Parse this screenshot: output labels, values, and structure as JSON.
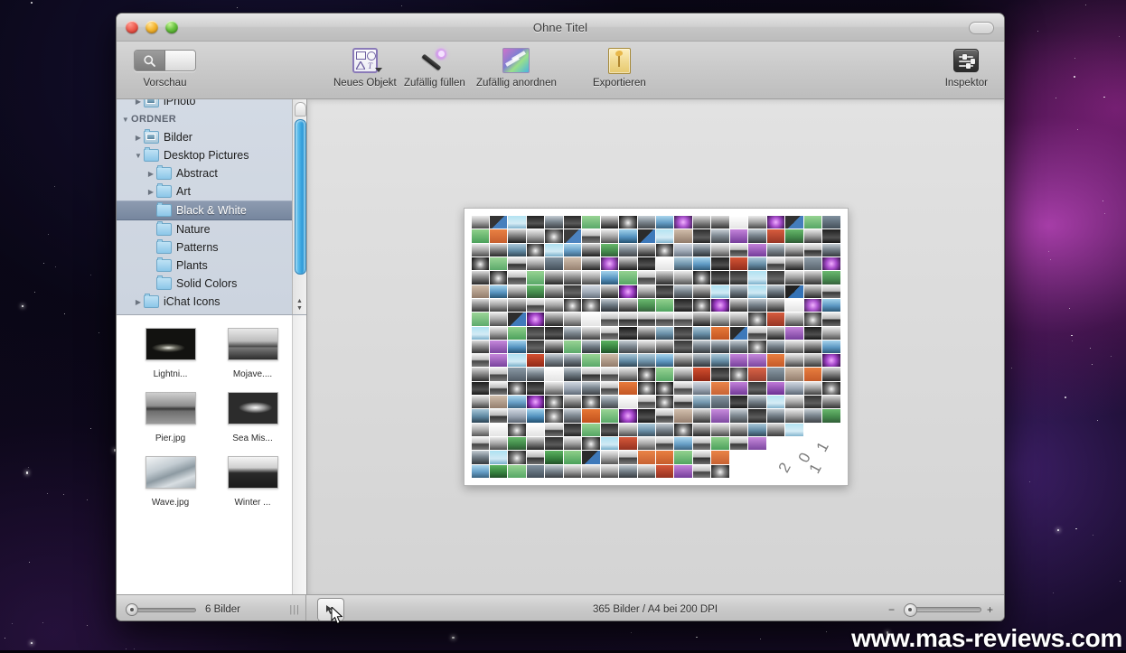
{
  "window": {
    "title": "Ohne Titel",
    "traffic_lights": [
      "close",
      "minimize",
      "zoom"
    ],
    "toolbar_toggle": "toolbar-toggle-pill"
  },
  "toolbar": {
    "items": [
      {
        "label": "Vorschau",
        "icon": "magnifier-icon",
        "type": "segmented"
      },
      {
        "label": "Neues Objekt",
        "icon": "new-object-icon",
        "type": "menu-button"
      },
      {
        "label": "Zufällig füllen",
        "icon": "magic-wand-icon",
        "type": "button"
      },
      {
        "label": "Zufällig anordnen",
        "icon": "shuffle-icon",
        "type": "button"
      },
      {
        "label": "Exportieren",
        "icon": "export-icon",
        "type": "button"
      },
      {
        "label": "Inspektor",
        "icon": "inspector-icon",
        "type": "button"
      }
    ]
  },
  "sidebar": {
    "tree": [
      {
        "label": "iPhoto",
        "depth": 1,
        "caret": "closed",
        "icon": "photo-folder-icon",
        "selected": false,
        "clipped": true
      },
      {
        "label": "ORDNER",
        "depth": 0,
        "caret": "open",
        "icon": "none",
        "selected": false,
        "group": true
      },
      {
        "label": "Bilder",
        "depth": 1,
        "caret": "closed",
        "icon": "photo-folder-icon",
        "selected": false
      },
      {
        "label": "Desktop Pictures",
        "depth": 1,
        "caret": "open",
        "icon": "folder-icon",
        "selected": false
      },
      {
        "label": "Abstract",
        "depth": 2,
        "caret": "closed",
        "icon": "folder-icon",
        "selected": false
      },
      {
        "label": "Art",
        "depth": 2,
        "caret": "closed",
        "icon": "folder-icon",
        "selected": false
      },
      {
        "label": "Black & White",
        "depth": 2,
        "caret": "none",
        "icon": "folder-icon",
        "selected": true
      },
      {
        "label": "Nature",
        "depth": 2,
        "caret": "none",
        "icon": "folder-icon",
        "selected": false
      },
      {
        "label": "Patterns",
        "depth": 2,
        "caret": "none",
        "icon": "folder-icon",
        "selected": false
      },
      {
        "label": "Plants",
        "depth": 2,
        "caret": "none",
        "icon": "folder-icon",
        "selected": false
      },
      {
        "label": "Solid Colors",
        "depth": 2,
        "caret": "none",
        "icon": "folder-icon",
        "selected": false
      },
      {
        "label": "iChat Icons",
        "depth": 1,
        "caret": "closed",
        "icon": "folder-icon",
        "selected": false
      }
    ],
    "thumbnails": [
      {
        "name": "Lightni...",
        "style": "t-lightning"
      },
      {
        "name": "Mojave....",
        "style": "t-mojave"
      },
      {
        "name": "Pier.jpg",
        "style": "t-pier"
      },
      {
        "name": "Sea Mis...",
        "style": "t-seamist"
      },
      {
        "name": "Wave.jpg",
        "style": "t-wave"
      },
      {
        "name": "Winter ...",
        "style": "t-winter"
      }
    ]
  },
  "statusbar": {
    "browser_count": "6 Bilder",
    "browser_slider_value": 0,
    "grip": "|||",
    "viewmode_icon": "arrow-cursor-icon",
    "document_status": "365 Bilder / A4 bei 200 DPI",
    "zoom_minus": "−",
    "zoom_plus": "+",
    "zoom_value": 8
  },
  "canvas": {
    "page_year": [
      "2",
      "0",
      "1",
      "1"
    ],
    "collage_columns": 20,
    "collage_rows": 19
  },
  "watermark": {
    "text": "www.mas-reviews.com"
  },
  "colors": {
    "selection_blue": "#76869e",
    "accent_purple": "#8a7ab8",
    "window_chrome": "#c9c9c9",
    "sidebar_tree": "#ccd4df"
  }
}
